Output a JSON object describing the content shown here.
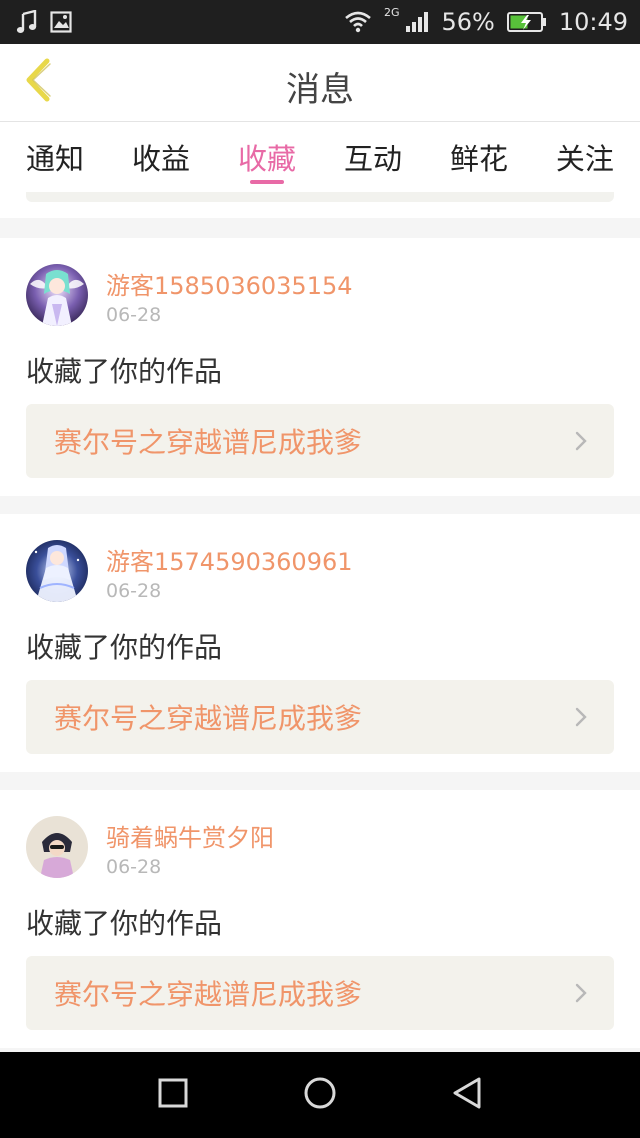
{
  "status_bar": {
    "network": "2G",
    "battery": "56%",
    "time": "10:49",
    "icons": [
      "music-icon",
      "image-icon",
      "wifi-icon",
      "signal-icon",
      "battery-icon"
    ]
  },
  "header": {
    "title": "消息",
    "back_icon": "chevron-left-icon"
  },
  "tabs": [
    {
      "label": "通知",
      "active": false
    },
    {
      "label": "收益",
      "active": false
    },
    {
      "label": "收藏",
      "active": true
    },
    {
      "label": "互动",
      "active": false
    },
    {
      "label": "鲜花",
      "active": false
    },
    {
      "label": "关注",
      "active": false
    }
  ],
  "messages": [
    {
      "username": "游客1585036035154",
      "date": "06-28",
      "action": "收藏了你的作品",
      "work_title": "赛尔号之穿越谱尼成我爹"
    },
    {
      "username": "游客1574590360961",
      "date": "06-28",
      "action": "收藏了你的作品",
      "work_title": "赛尔号之穿越谱尼成我爹"
    },
    {
      "username": "骑着蜗牛赏夕阳",
      "date": "06-28",
      "action": "收藏了你的作品",
      "work_title": "赛尔号之穿越谱尼成我爹"
    }
  ],
  "nav_bar": {
    "icons": [
      "recent-apps-icon",
      "home-icon",
      "back-icon"
    ]
  },
  "colors": {
    "accent": "#e86aa6",
    "username": "#f0956a",
    "work_title": "#f0956a",
    "back_arrow": "#e8d84a"
  }
}
